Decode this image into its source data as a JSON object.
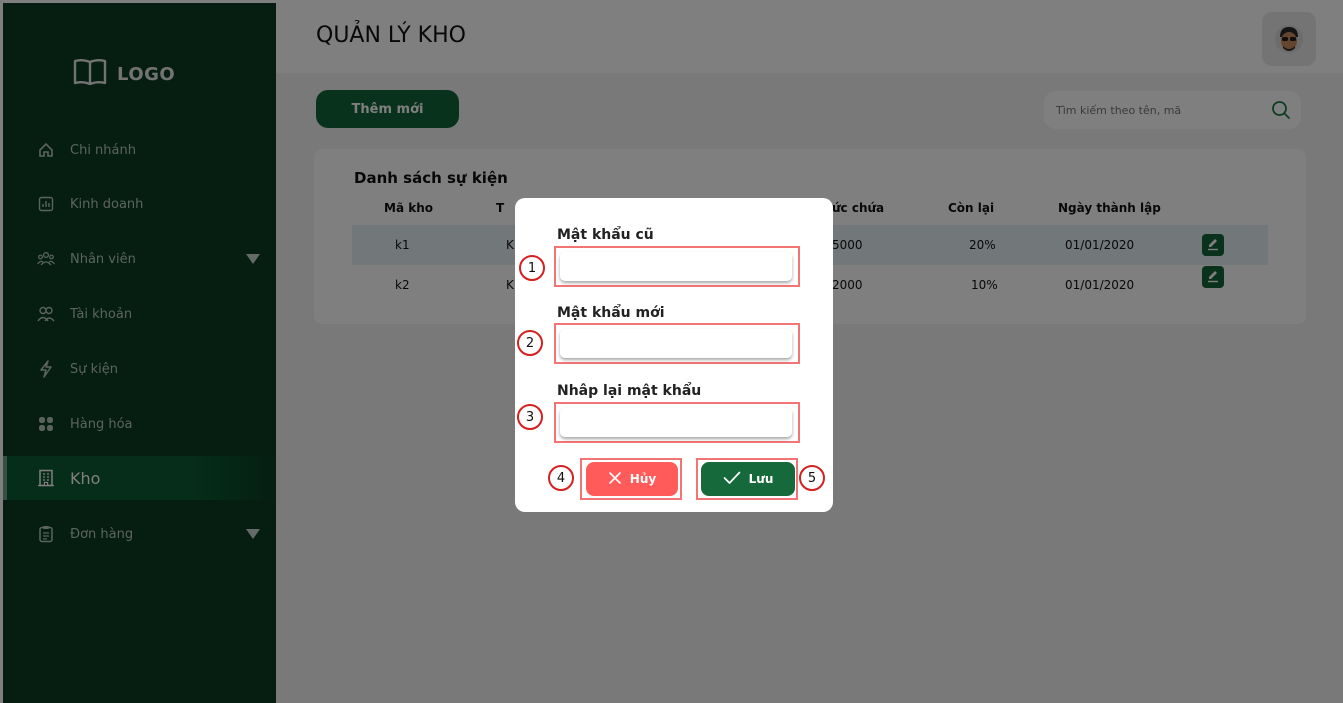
{
  "sidebar": {
    "logo_text": "LOGO",
    "items": [
      {
        "label": "Chi nhánh",
        "icon": "home-icon"
      },
      {
        "label": "Kinh doanh",
        "icon": "chart-icon"
      },
      {
        "label": "Nhân viên",
        "icon": "users-icon",
        "expandable": true
      },
      {
        "label": "Tài khoản",
        "icon": "user-pair-icon"
      },
      {
        "label": "Sự kiện",
        "icon": "lightning-icon"
      },
      {
        "label": "Hàng hóa",
        "icon": "grid-icon"
      },
      {
        "label": "Kho",
        "icon": "building-icon",
        "active": true
      },
      {
        "label": "Đơn hàng",
        "icon": "clipboard-icon",
        "expandable": true
      }
    ]
  },
  "header": {
    "title": "QUẢN LÝ KHO"
  },
  "toolbar": {
    "add_label": "Thêm mới",
    "search_placeholder": "Tìm kiếm theo tên, mã"
  },
  "table": {
    "title": "Danh sách sự kiện",
    "headers": {
      "code": "Mã kho",
      "name": "T",
      "capacity": "ức chứa",
      "remaining": "Còn lại",
      "founded": "Ngày thành lập"
    },
    "rows": [
      {
        "code": "k1",
        "name": "K",
        "capacity": "5000",
        "remaining": "20%",
        "founded": "01/01/2020"
      },
      {
        "code": "k2",
        "name": "K",
        "capacity": "2000",
        "remaining": "10%",
        "founded": "01/01/2020"
      }
    ]
  },
  "dialog": {
    "old_password_label": "Mật khẩu cũ",
    "new_password_label": "Mật khẩu mới",
    "confirm_password_label": "Nhâp lại mật khẩu",
    "cancel_label": "Hủy",
    "save_label": "Lưu",
    "markers": [
      "1",
      "2",
      "3",
      "4",
      "5"
    ]
  },
  "colors": {
    "sidebar_bg": "#0b3d23",
    "primary": "#106437",
    "cancel": "#ff5b5b",
    "highlight": "#f27474"
  }
}
